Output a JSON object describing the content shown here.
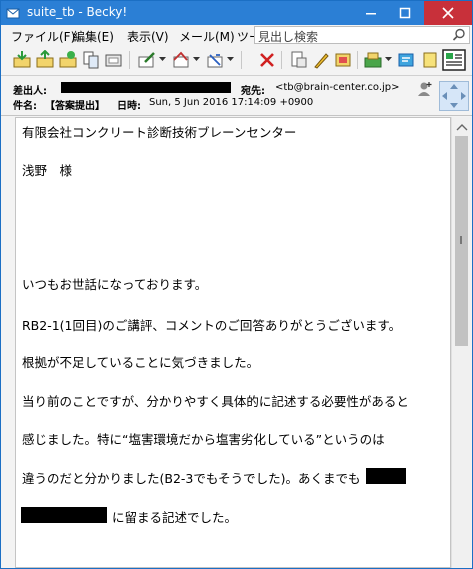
{
  "window": {
    "title": "suite_tb - Becky!"
  },
  "menu": {
    "items": [
      "ファイル(F)",
      "編集(E)",
      "表示(V)",
      "メール(M)",
      "ツー"
    ]
  },
  "search": {
    "placeholder": "見出し検索"
  },
  "header": {
    "from_label": "差出人:",
    "to_label": "宛先:",
    "to_value": "<tb@brain-center.co.jp>",
    "subject_label": "件名:",
    "subject_value": "【答案提出】",
    "date_label": "日時:",
    "date_value": "Sun, 5 Jun 2016 17:14:09 +0900"
  },
  "body": {
    "lines": [
      "有限会社コンクリート診断技術ブレーンセンター",
      "浅野　様",
      "いつもお世話になっております。",
      "RB2-1(1回目)のご講評、コメントのご回答ありがとうございます。",
      "根拠が不足していることに気づきました。",
      "当り前のことですが、分かりやすく具体的に記述する必要性があると",
      "感じました。特に“塩害環境だから塩害劣化している”というのは",
      "違うのだと分かりました(B2-3でもそうでした)。あくまでも",
      "に留まる記述でした。"
    ]
  },
  "colors": {
    "titlebar": "#2b7fd5",
    "close": "#c8303a",
    "redaction": "#000000"
  },
  "icons": [
    "receive-mail-icon",
    "send-mail-icon",
    "new-mail-icon",
    "address-book-icon",
    "write-mail-icon",
    "reply-icon",
    "forward-icon",
    "delete-icon",
    "filter-icon",
    "edit-icon",
    "attachment-icon",
    "print-icon",
    "collect-icon",
    "help-icon",
    "settings-icon"
  ]
}
